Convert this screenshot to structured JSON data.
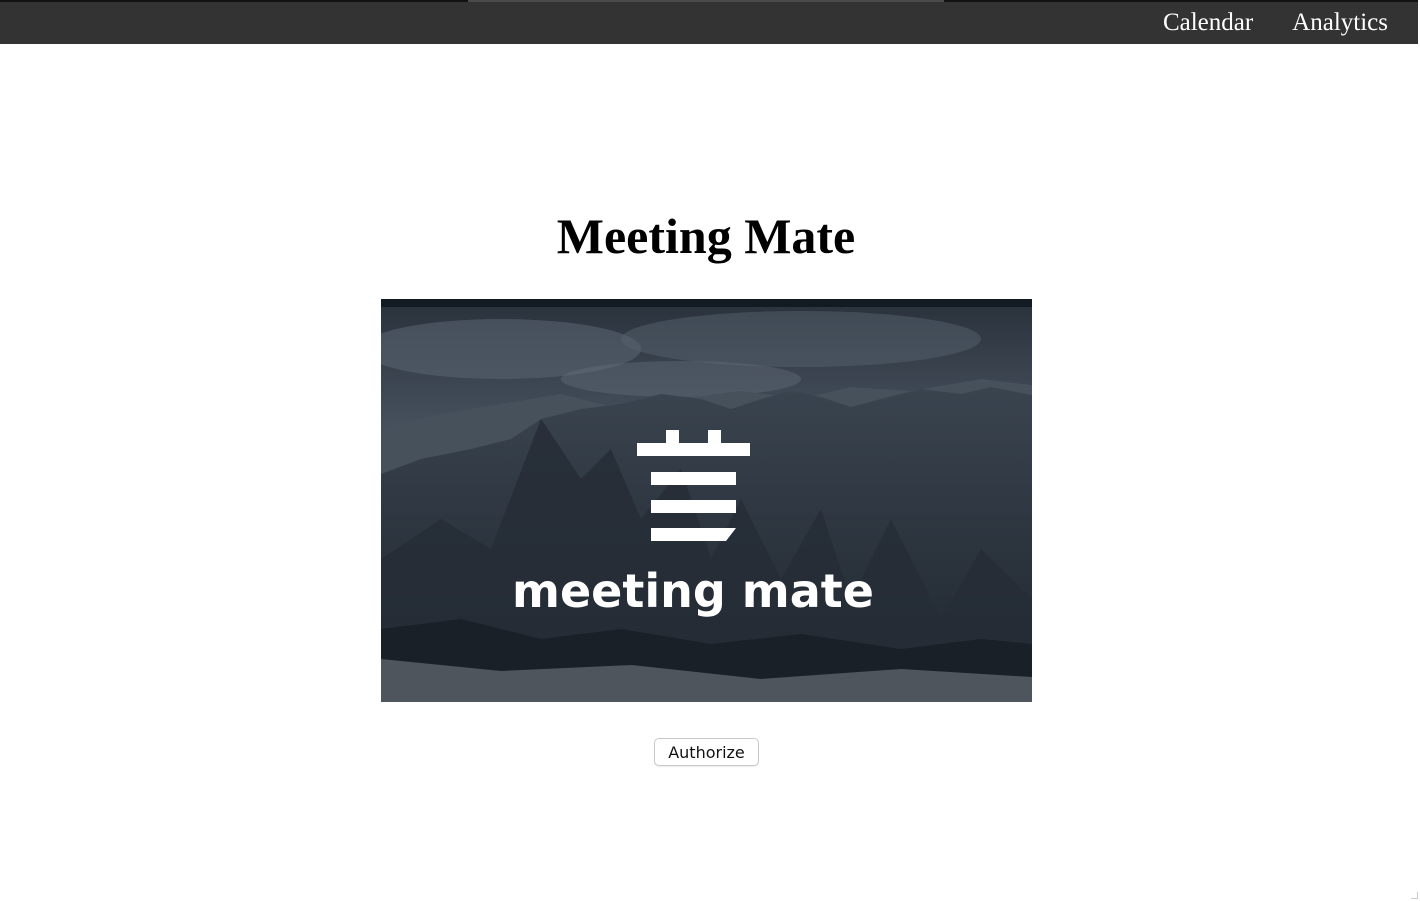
{
  "nav": {
    "items": [
      {
        "label": "Calendar"
      },
      {
        "label": "Analytics"
      }
    ]
  },
  "main": {
    "title": "Meeting Mate",
    "authorize_label": "Authorize"
  },
  "hero": {
    "logo_text": "meeting mate",
    "logo_icon": "calendar-stack-icon",
    "background": "dark-mountain-landscape"
  },
  "colors": {
    "topbar": "#333333",
    "nav_text": "#ffffff",
    "title": "#000000",
    "hero_tint": "#1c2430",
    "logo": "#ffffff"
  }
}
